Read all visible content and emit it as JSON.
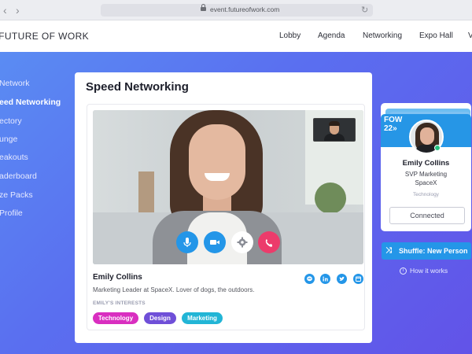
{
  "browser": {
    "url": "event.futureofwork.com",
    "back_icon": "‹",
    "forward_icon": "›",
    "reload_icon": "↻"
  },
  "topnav": {
    "brand": "E FUTURE OF WORK",
    "items": [
      "Lobby",
      "Agenda",
      "Networking",
      "Expo Hall",
      "V"
    ]
  },
  "sidebar": {
    "items": [
      {
        "label": "Network",
        "active": false
      },
      {
        "label": "eed Networking",
        "active": true
      },
      {
        "label": "ectory",
        "active": false
      },
      {
        "label": "unge",
        "active": false
      },
      {
        "label": "eakouts",
        "active": false
      },
      {
        "label": "aderboard",
        "active": false
      },
      {
        "label": "ze Packs",
        "active": false
      },
      {
        "label": "Profile",
        "active": false
      }
    ]
  },
  "main": {
    "title": "Speed Networking",
    "person": {
      "name": "Emily Collins",
      "bio": "Marketing Leader at SpaceX. Lover of dogs, the outdoors.",
      "interests_label": "EMILY'S INTERESTS",
      "interests": [
        "Technology",
        "Design",
        "Marketing"
      ]
    },
    "controls": [
      "microphone",
      "camera",
      "settings",
      "end-call"
    ],
    "social": [
      "messenger",
      "linkedin",
      "twitter",
      "calendar"
    ]
  },
  "match_card": {
    "badge_line1": "FOW",
    "badge_line2": "22»",
    "pattern": "↗ ↘ ↗",
    "name": "Emily Collins",
    "role": "SVP Marketing",
    "company": "SpaceX",
    "category": "Technology",
    "status_button": "Connected"
  },
  "actions": {
    "shuffle_label": "Shuffle: New Person",
    "shuffle_icon": "⤨",
    "help_label": "How it works",
    "help_icon": "i"
  },
  "colors": {
    "accent": "#2496e8",
    "end_call": "#ec3b6b",
    "tag_technology": "#d92ec0",
    "tag_design": "#6f4fd8",
    "tag_marketing": "#22b5d6",
    "gradient_start": "#5a8cf3",
    "gradient_end": "#6253e8"
  }
}
